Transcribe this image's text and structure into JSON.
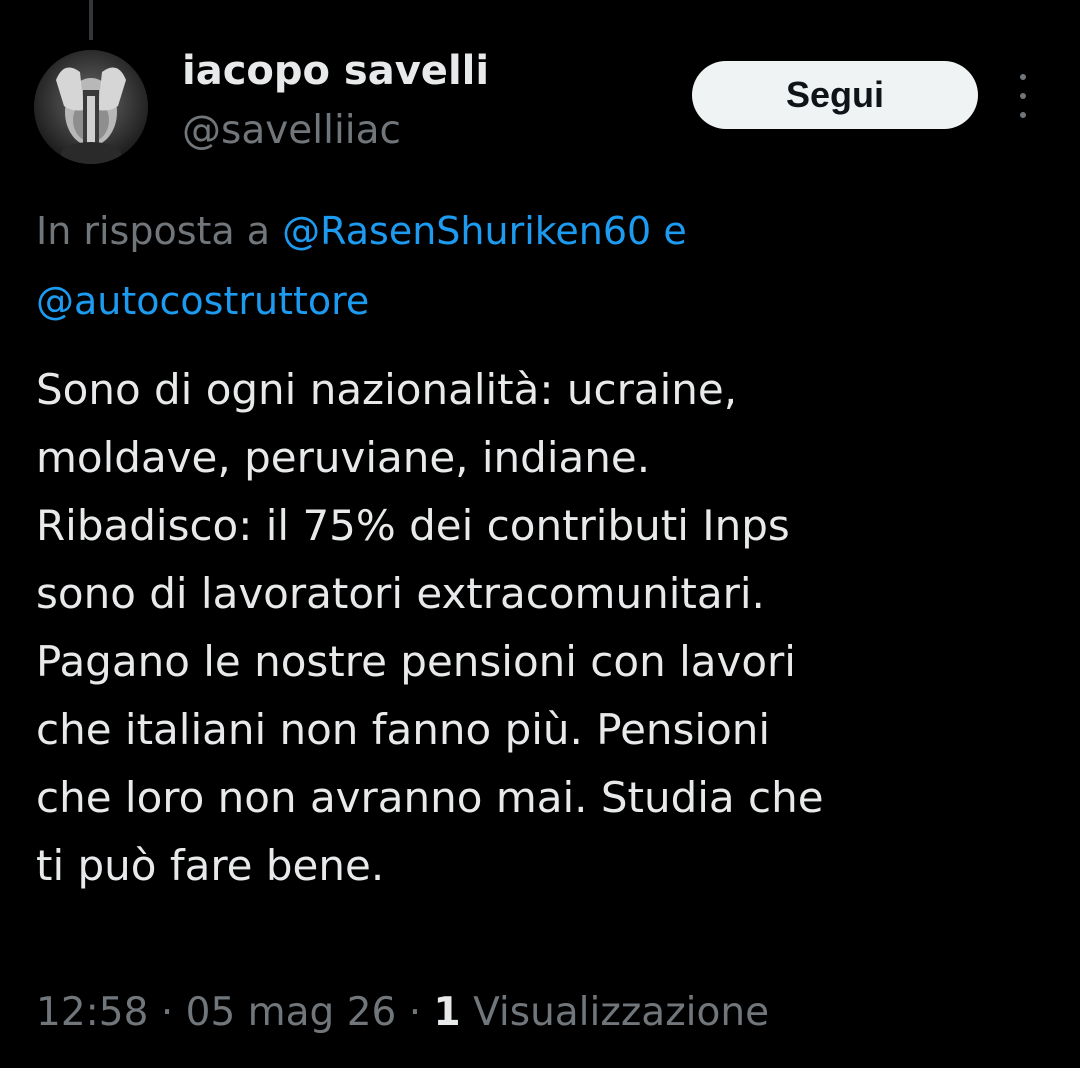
{
  "author": {
    "display_name": "iacopo savelli",
    "handle": "@savelliiac"
  },
  "follow_button": {
    "label": "Segui"
  },
  "reply_context": {
    "prefix": "In risposta a",
    "mention_1": "@RasenShuriken60",
    "conjunction": "e",
    "mention_2": "@autocostruttore"
  },
  "tweet": {
    "lines": [
      "Sono di ogni nazionalità: ucraine,",
      "moldave, peruviane, indiane.",
      "Ribadisco: il 75% dei contributi Inps",
      "sono di lavoratori extracomunitari.",
      "Pagano le nostre pensioni con lavori",
      "che italiani non fanno più. Pensioni",
      "che loro non avranno mai. Studia che",
      "ti può fare bene."
    ]
  },
  "meta": {
    "time": "12:58",
    "separator": "·",
    "date": "05 mag 26",
    "views_count": "1",
    "views_label": "Visualizzazione"
  },
  "icons": {
    "more": "more-vertical-icon"
  },
  "colors": {
    "background": "#000000",
    "text_primary": "#e7e9ea",
    "text_secondary": "#71767b",
    "link": "#1d9bf0",
    "button_bg": "#eff3f4",
    "button_text": "#0f1419"
  }
}
